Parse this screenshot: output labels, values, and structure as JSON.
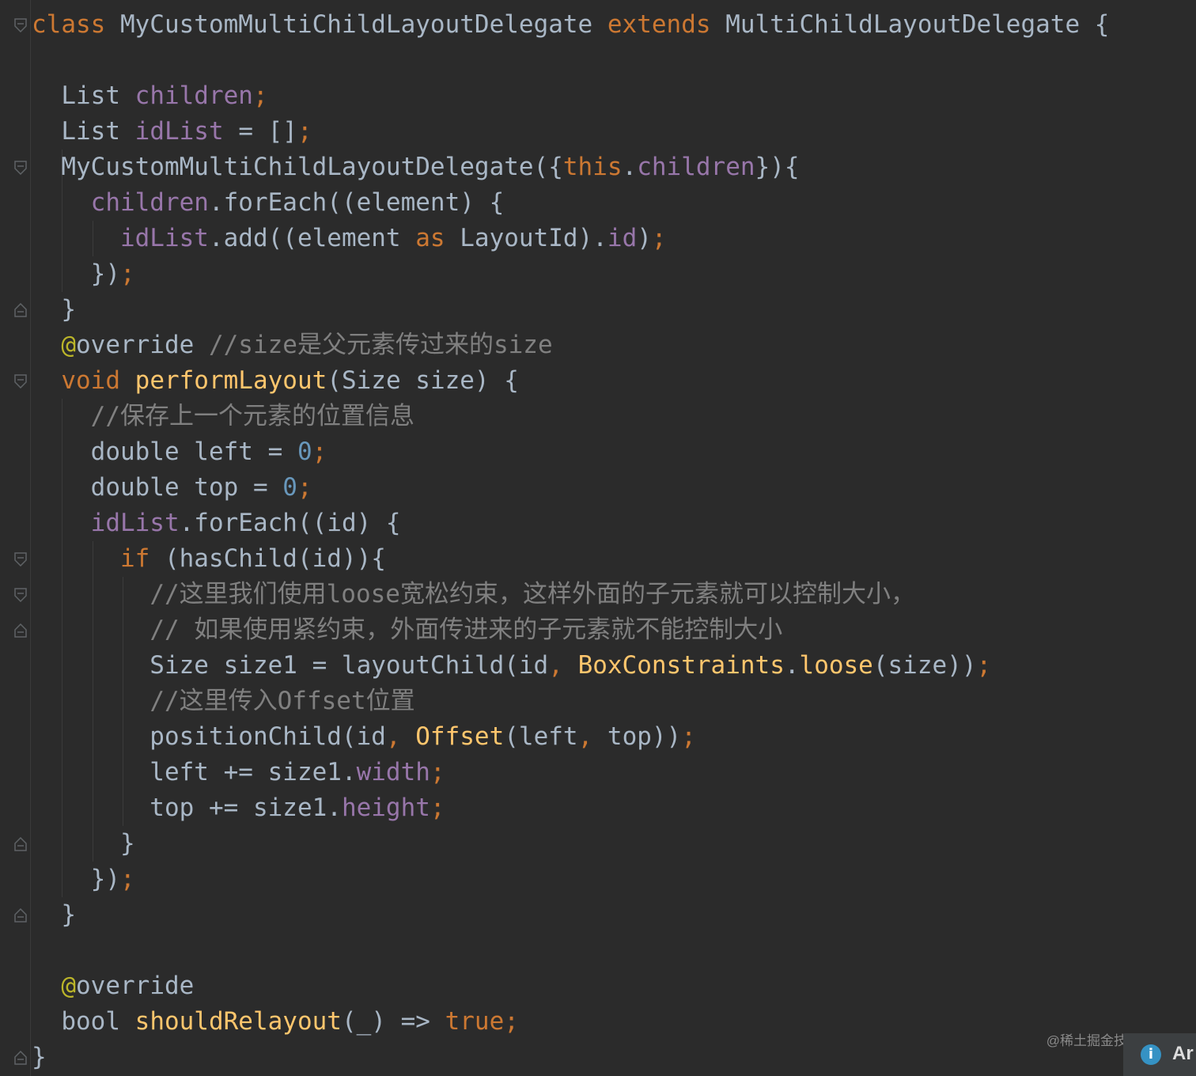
{
  "editor": {
    "language": "Dart",
    "theme": "Darcula",
    "colors": {
      "background": "#2b2b2b",
      "keyword": "#cc7832",
      "field": "#9876aa",
      "function": "#ffc66d",
      "number": "#6897bb",
      "comment": "#808080",
      "annotation": "#bbb529",
      "plain": "#a9b7c6"
    },
    "lines": [
      [
        {
          "c": "kw",
          "t": "class "
        },
        {
          "c": "plain",
          "t": "MyCustomMultiChildLayoutDelegate "
        },
        {
          "c": "kw",
          "t": "extends "
        },
        {
          "c": "plain",
          "t": "MultiChildLayoutDelegate {"
        }
      ],
      [],
      [
        {
          "c": "plain",
          "t": "  List "
        },
        {
          "c": "field",
          "t": "children"
        },
        {
          "c": "kw",
          "t": ";"
        }
      ],
      [
        {
          "c": "plain",
          "t": "  List "
        },
        {
          "c": "field",
          "t": "idList "
        },
        {
          "c": "plain",
          "t": "= []"
        },
        {
          "c": "kw",
          "t": ";"
        }
      ],
      [
        {
          "c": "plain",
          "t": "  MyCustomMultiChildLayoutDelegate({"
        },
        {
          "c": "kw",
          "t": "this"
        },
        {
          "c": "plain",
          "t": "."
        },
        {
          "c": "field",
          "t": "children"
        },
        {
          "c": "plain",
          "t": "}){"
        }
      ],
      [
        {
          "c": "plain",
          "t": "    "
        },
        {
          "c": "field",
          "t": "children"
        },
        {
          "c": "plain",
          "t": ".forEach((element) {"
        }
      ],
      [
        {
          "c": "plain",
          "t": "      "
        },
        {
          "c": "field",
          "t": "idList"
        },
        {
          "c": "plain",
          "t": ".add((element "
        },
        {
          "c": "kw",
          "t": "as "
        },
        {
          "c": "plain",
          "t": "LayoutId)."
        },
        {
          "c": "field",
          "t": "id"
        },
        {
          "c": "plain",
          "t": ")"
        },
        {
          "c": "kw",
          "t": ";"
        }
      ],
      [
        {
          "c": "plain",
          "t": "    })"
        },
        {
          "c": "kw",
          "t": ";"
        }
      ],
      [
        {
          "c": "plain",
          "t": "  }"
        }
      ],
      [
        {
          "c": "plain",
          "t": "  "
        },
        {
          "c": "ann",
          "t": "@"
        },
        {
          "c": "plain",
          "t": "override "
        },
        {
          "c": "cmt",
          "t": "//size是父元素传过来的size"
        }
      ],
      [
        {
          "c": "plain",
          "t": "  "
        },
        {
          "c": "kw",
          "t": "void "
        },
        {
          "c": "fn",
          "t": "performLayout"
        },
        {
          "c": "plain",
          "t": "(Size size) {"
        }
      ],
      [
        {
          "c": "plain",
          "t": "    "
        },
        {
          "c": "cmt",
          "t": "//保存上一个元素的位置信息"
        }
      ],
      [
        {
          "c": "plain",
          "t": "    double left = "
        },
        {
          "c": "num",
          "t": "0"
        },
        {
          "c": "kw",
          "t": ";"
        }
      ],
      [
        {
          "c": "plain",
          "t": "    double top = "
        },
        {
          "c": "num",
          "t": "0"
        },
        {
          "c": "kw",
          "t": ";"
        }
      ],
      [
        {
          "c": "plain",
          "t": "    "
        },
        {
          "c": "field",
          "t": "idList"
        },
        {
          "c": "plain",
          "t": ".forEach((id) {"
        }
      ],
      [
        {
          "c": "plain",
          "t": "      "
        },
        {
          "c": "kw",
          "t": "if "
        },
        {
          "c": "plain",
          "t": "(hasChild(id)){"
        }
      ],
      [
        {
          "c": "plain",
          "t": "        "
        },
        {
          "c": "cmt",
          "t": "//这里我们使用loose宽松约束，这样外面的子元素就可以控制大小，"
        }
      ],
      [
        {
          "c": "plain",
          "t": "        "
        },
        {
          "c": "cmt",
          "t": "// 如果使用紧约束，外面传进来的子元素就不能控制大小"
        }
      ],
      [
        {
          "c": "plain",
          "t": "        Size size1 = layoutChild(id"
        },
        {
          "c": "kw",
          "t": ", "
        },
        {
          "c": "fn",
          "t": "BoxConstraints"
        },
        {
          "c": "plain",
          "t": "."
        },
        {
          "c": "fn",
          "t": "loose"
        },
        {
          "c": "plain",
          "t": "(size))"
        },
        {
          "c": "kw",
          "t": ";"
        }
      ],
      [
        {
          "c": "plain",
          "t": "        "
        },
        {
          "c": "cmt",
          "t": "//这里传入Offset位置"
        }
      ],
      [
        {
          "c": "plain",
          "t": "        positionChild(id"
        },
        {
          "c": "kw",
          "t": ", "
        },
        {
          "c": "fn",
          "t": "Offset"
        },
        {
          "c": "plain",
          "t": "(left"
        },
        {
          "c": "kw",
          "t": ", "
        },
        {
          "c": "plain",
          "t": "top))"
        },
        {
          "c": "kw",
          "t": ";"
        }
      ],
      [
        {
          "c": "plain",
          "t": "        left += size1."
        },
        {
          "c": "field",
          "t": "width"
        },
        {
          "c": "kw",
          "t": ";"
        }
      ],
      [
        {
          "c": "plain",
          "t": "        top += size1."
        },
        {
          "c": "field",
          "t": "height"
        },
        {
          "c": "kw",
          "t": ";"
        }
      ],
      [
        {
          "c": "plain",
          "t": "      }"
        }
      ],
      [
        {
          "c": "plain",
          "t": "    })"
        },
        {
          "c": "kw",
          "t": ";"
        }
      ],
      [
        {
          "c": "plain",
          "t": "  }"
        }
      ],
      [],
      [
        {
          "c": "plain",
          "t": "  "
        },
        {
          "c": "ann",
          "t": "@"
        },
        {
          "c": "plain",
          "t": "override"
        }
      ],
      [
        {
          "c": "plain",
          "t": "  bool "
        },
        {
          "c": "fn",
          "t": "shouldRelayout"
        },
        {
          "c": "plain",
          "t": "(_) => "
        },
        {
          "c": "kw",
          "t": "true;"
        }
      ],
      [
        {
          "c": "plain",
          "t": "}"
        }
      ]
    ],
    "fold_markers": [
      {
        "line": 0,
        "kind": "fold-open-icon"
      },
      {
        "line": 4,
        "kind": "fold-open-icon"
      },
      {
        "line": 8,
        "kind": "fold-close-icon"
      },
      {
        "line": 10,
        "kind": "fold-open-icon"
      },
      {
        "line": 15,
        "kind": "fold-open-icon"
      },
      {
        "line": 16,
        "kind": "fold-open-icon"
      },
      {
        "line": 17,
        "kind": "fold-close-icon"
      },
      {
        "line": 23,
        "kind": "fold-close-icon"
      },
      {
        "line": 25,
        "kind": "fold-close-icon"
      },
      {
        "line": 29,
        "kind": "fold-close-icon"
      }
    ]
  },
  "watermark": "@稀土掘金技术社区",
  "notification": {
    "icon": "info-icon",
    "icon_glyph": "i",
    "text": "Ar"
  }
}
